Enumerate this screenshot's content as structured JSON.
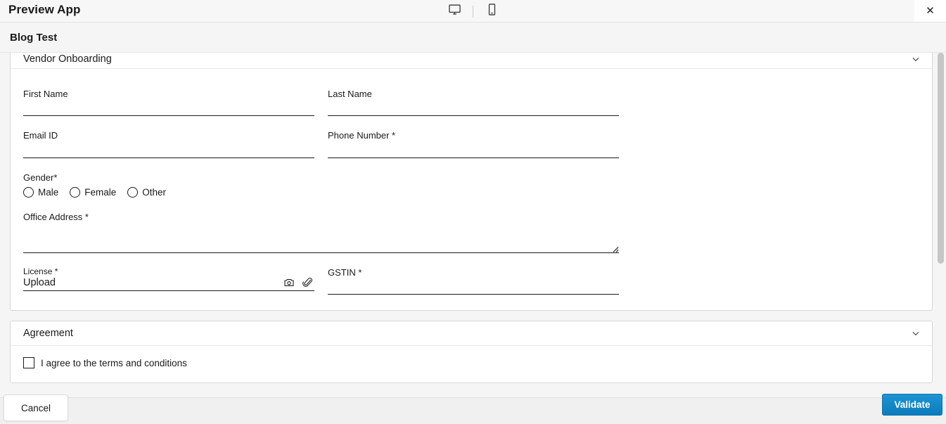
{
  "titlebar": {
    "title": "Preview App",
    "devices": [
      {
        "name": "desktop-view-icon",
        "label": "Desktop"
      },
      {
        "name": "mobile-view-icon",
        "label": "Mobile"
      }
    ],
    "close_label": "✕"
  },
  "subheader": {
    "title": "Blog Test"
  },
  "sections": [
    {
      "title": "Vendor Onboarding",
      "chevron": "chevron-down-icon"
    },
    {
      "title": "Agreement",
      "chevron": "chevron-down-icon"
    }
  ],
  "form": {
    "first_name": {
      "label": "First Name",
      "value": "",
      "placeholder": ""
    },
    "last_name": {
      "label": "Last Name",
      "value": "",
      "placeholder": ""
    },
    "email_id": {
      "label": "Email ID",
      "value": "",
      "placeholder": ""
    },
    "phone_number": {
      "label": "Phone Number *",
      "value": "",
      "placeholder": ""
    },
    "gender": {
      "label": "Gender*",
      "options": [
        {
          "label": "Male",
          "selected": false
        },
        {
          "label": "Female",
          "selected": false
        },
        {
          "label": "Other",
          "selected": false
        }
      ]
    },
    "office_address": {
      "label": "Office Address *",
      "value": "",
      "placeholder": ""
    },
    "license": {
      "label": "License *",
      "upload_text": "Upload",
      "camera_icon": "camera-icon",
      "attach_icon": "paperclip-icon"
    },
    "gstin": {
      "label": "GSTIN *",
      "value": "",
      "placeholder": ""
    }
  },
  "agreement": {
    "checkbox_label": "I agree to the terms and conditions",
    "checked": false
  },
  "footer": {
    "cancel_label": "Cancel",
    "validate_label": "Validate"
  },
  "colors": {
    "accent": "#0b7cbd",
    "page_bg": "#f5f5f5",
    "card_bg": "#ffffff",
    "text": "#1a1a1a"
  }
}
